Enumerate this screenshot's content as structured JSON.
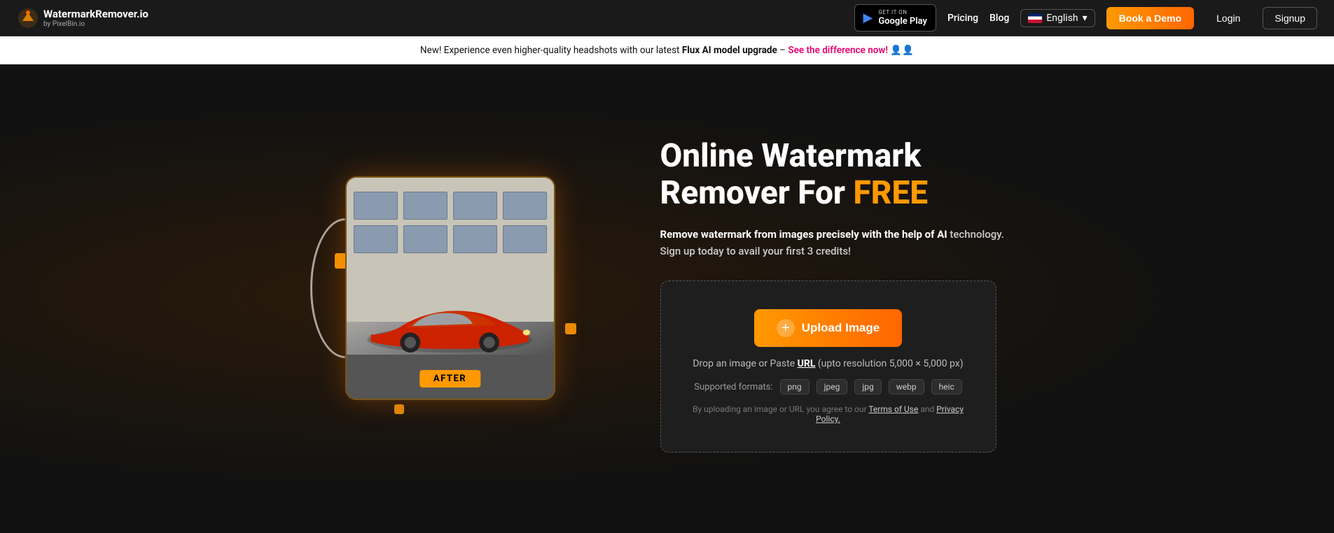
{
  "navbar": {
    "logo_title": "WatermarkRemover.io",
    "logo_sub": "by PixelBin.io",
    "google_play_get_it": "GET IT ON",
    "google_play_label": "Google Play",
    "nav_pricing": "Pricing",
    "nav_blog": "Blog",
    "lang": "English",
    "book_demo": "Book a Demo",
    "login": "Login",
    "signup": "Signup"
  },
  "announcement": {
    "text_before": "New! Experience even higher-quality headshots with our latest ",
    "highlight": "Flux AI model upgrade",
    "dash": " – ",
    "cta_text": "See the difference now!",
    "emoji": "👤👤"
  },
  "hero": {
    "title_line1": "Online Watermark",
    "title_line2": "Remover For ",
    "title_free": "FREE",
    "subtitle_bold": "Remove watermark from images precisely with the help of AI",
    "subtitle_normal": "technology. Sign up today to avail your first 3 credits!",
    "after_badge": "AFTER",
    "upload_btn_label": "Upload Image",
    "drop_text_before": "Drop an image or Paste ",
    "drop_url": "URL",
    "drop_text_after": " (upto resolution 5,000 × 5,000 px)",
    "formats_label": "Supported formats:",
    "formats": [
      "png",
      "jpeg",
      "jpg",
      "webp",
      "heic"
    ],
    "terms_before": "By uploading an image or URL you agree to our ",
    "terms_link1": "Terms of Use",
    "terms_and": " and ",
    "terms_link2": "Privacy Policy.",
    "plus_icon": "+"
  }
}
